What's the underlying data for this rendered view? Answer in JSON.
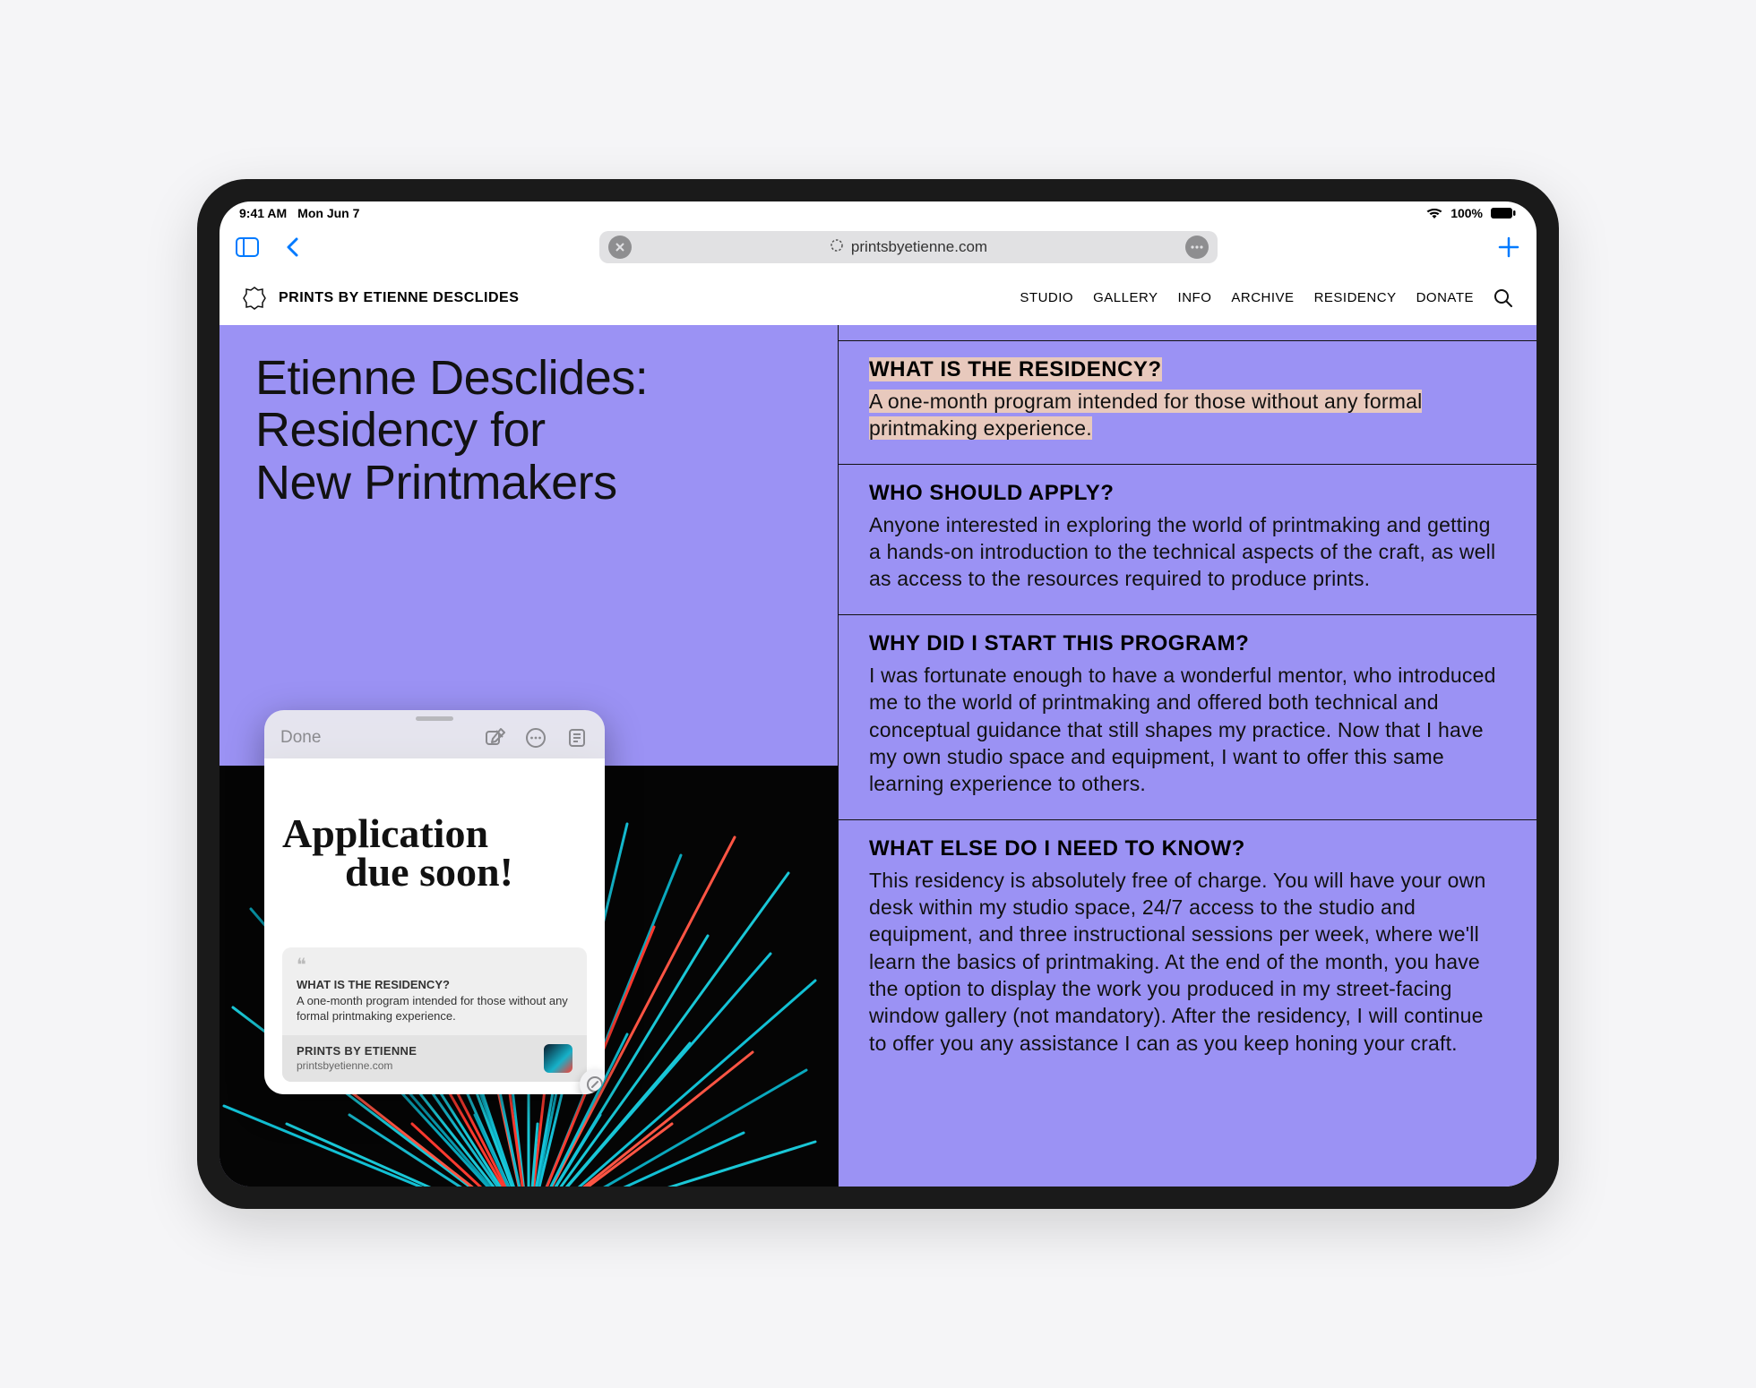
{
  "status": {
    "time": "9:41 AM",
    "date": "Mon Jun 7",
    "battery": "100%"
  },
  "safari": {
    "url": "printsbyetienne.com"
  },
  "site": {
    "brand": "PRINTS BY ETIENNE DESCLIDES",
    "nav": [
      "STUDIO",
      "GALLERY",
      "INFO",
      "ARCHIVE",
      "RESIDENCY",
      "DONATE"
    ]
  },
  "hero": {
    "title": "Etienne Desclides:\nResidency for\nNew Printmakers"
  },
  "faqs": [
    {
      "q": "WHAT IS THE RESIDENCY?",
      "a": "A one-month program intended for those without any formal printmaking experience.",
      "highlighted": true
    },
    {
      "q": "WHO SHOULD APPLY?",
      "a": "Anyone interested in exploring the world of printmaking and getting a hands-on introduction to the technical aspects of the craft, as well as access to the resources required to produce prints."
    },
    {
      "q": "WHY DID I START THIS PROGRAM?",
      "a": "I was fortunate enough to have a wonderful mentor, who introduced me to the world of printmaking and offered both technical and conceptual guidance that still shapes my practice. Now that I have my own studio space and equipment, I want to offer this same learning experience to others."
    },
    {
      "q": "WHAT ELSE DO I NEED TO KNOW?",
      "a": "This residency is absolutely free of charge. You will have your own desk within my studio space, 24/7 access to the studio and equipment, and three instructional sessions per week, where we'll learn the basics of printmaking. At the end of the month, you have the option to display the work you produced in my street-facing window gallery (not mandatory). After the residency, I will continue to offer you any assistance I can as you keep honing your craft."
    }
  ],
  "quicknote": {
    "done": "Done",
    "handwriting_line1": "Application",
    "handwriting_line2": "due soon!",
    "quote_title": "WHAT IS THE RESIDENCY?",
    "quote_text": "A one-month program intended for those without any formal printmaking experience.",
    "src_title": "PRINTS BY ETIENNE",
    "src_sub": "printsbyetienne.com"
  }
}
